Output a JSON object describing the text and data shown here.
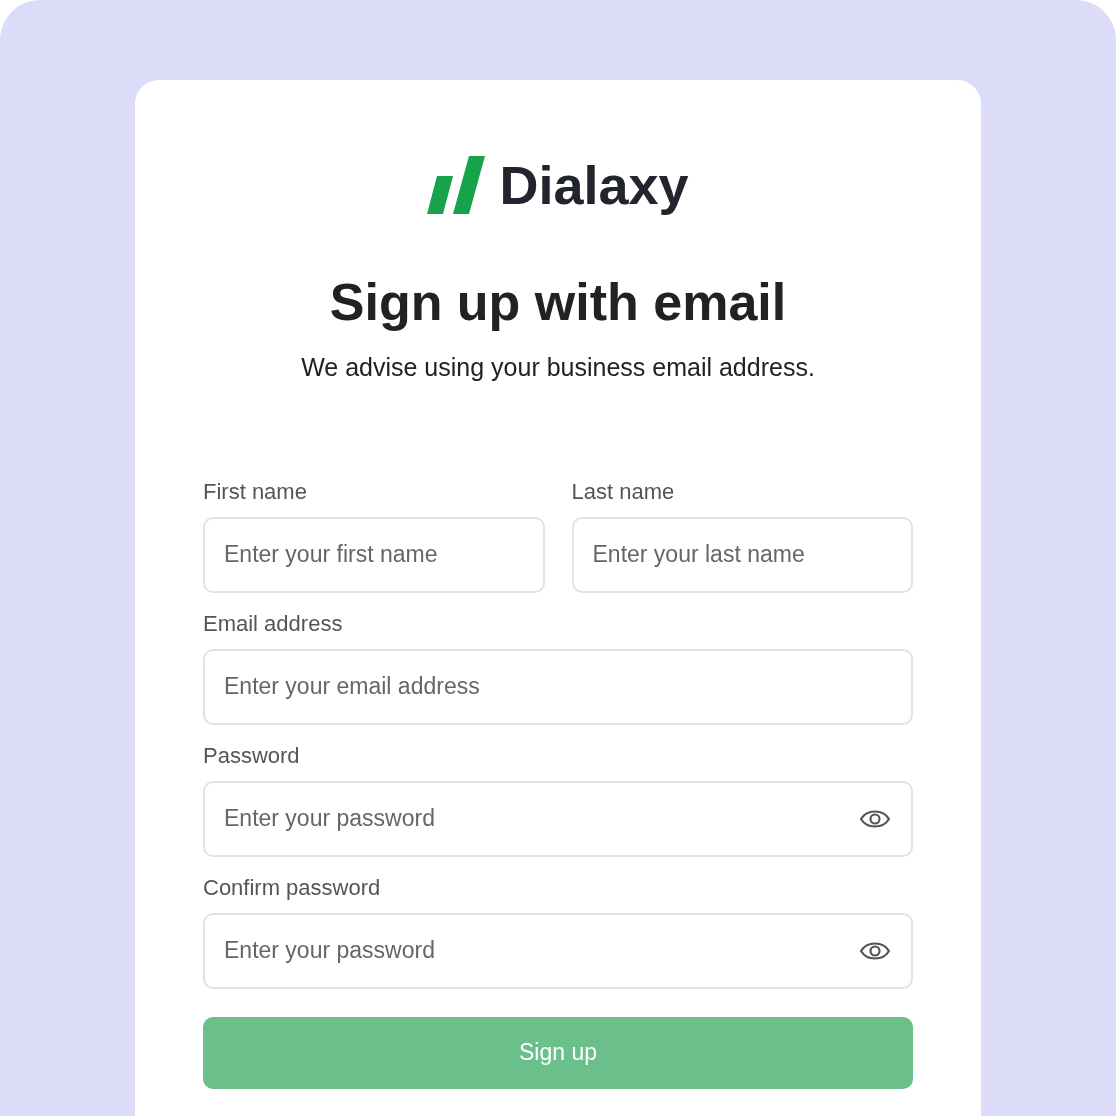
{
  "brand": "Dialaxy",
  "heading": "Sign up with email",
  "subtitle": "We advise using your business email address.",
  "rows": [
    [
      {
        "label": "First name",
        "placeholder": "Enter your first name",
        "kind": "text"
      },
      {
        "label": "Last name",
        "placeholder": "Enter your last name",
        "kind": "text"
      }
    ],
    [
      {
        "label": "Email address",
        "placeholder": "Enter your email address",
        "kind": "text"
      }
    ],
    [
      {
        "label": "Password",
        "placeholder": "Enter your password",
        "kind": "password"
      }
    ],
    [
      {
        "label": "Confirm password",
        "placeholder": "Enter your password",
        "kind": "password"
      }
    ]
  ],
  "submit": {
    "label": "Sign up",
    "disabled": true
  }
}
